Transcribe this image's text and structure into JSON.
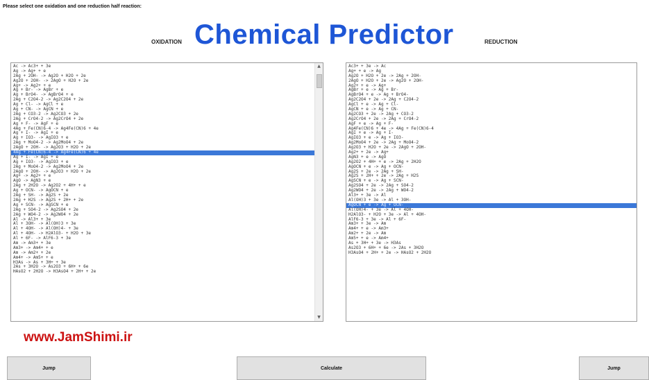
{
  "instruction": "Please select one oxidation and one reduction half reaction:",
  "title": "Chemical Predictor",
  "oxidation_label": "OXIDATION",
  "reduction_label": "REDUCTION",
  "oxidation_list": {
    "selected_index": 18,
    "items": [
      "Ac -> Ac3+ + 3e",
      "Ag -> Ag+ + e",
      "2Ag + 2OH- -> Ag2O + H2O + 2e",
      "Ag2O + 2OH- -> 2AgO + H2O + 2e",
      "Ag+ -> Ag2+ + e",
      "Ag + Br- -> AgBr + e",
      "Ag + BrO4- -> AgBrO4 + e",
      "2Ag + C2O4-2 -> Ag2C2O4 + 2e",
      "Ag + Cl- -> AgCl + e",
      "Ag + CN- -> AgCN + e",
      "2Ag + CO3-2 -> Ag2CO3 + 2e",
      "2Ag + CrO4-2 -> Ag2CrO4 + 2e",
      "Ag + F- -> AgF + e",
      "4Ag + Fe(CN)6-4 -> Ag4Fe(CN)6 + 4e",
      "Ag + I- -> AgI + e",
      "Ag + IO3- -> AgIO3 + e",
      "2Ag + MoO4-2 -> Ag2MoO4 + 2e",
      "2AgO + 2OH- -> Ag2O3 + H2O + 2e",
      "4Ag + Fe(CN)6-4 -> Ag4Fe(CN)6 + 4e",
      "Ag + I- -> AgI + e",
      "Ag + IO3- -> AgIO3 + e",
      "2Ag + MoO4-2 -> Ag2MoO4 + 2e",
      "2AgO + 2OH- -> Ag2O3 + H2O + 2e",
      "Ag+ -> Ag2+ + e",
      "AgO -> AgN3 + e",
      "2Ag + 2H2O -> Ag2O2 + 4H+ + e",
      "Ag + OCN- -> AgOCN + e",
      "2Ag + SH- -> Ag2S + 2e",
      "2Ag + H2S -> Ag2S + 2H+ + 2e",
      "Ag + SCN- -> AgSCN + e",
      "2Ag + SO4-2 -> Ag2SO4 + 2e",
      "2Ag + WO4-2 -> Ag2WO4 + 2e",
      "Al -> Al3+ + 3e",
      "Al + 3OH- -> Al(OH)3 + 3e",
      "Al + 4OH- -> Al(OH)4- + 3e",
      "Al + 4OH- -> H2AlO3- + H2O + 3e",
      "Al + 6F- -> AlF6-3 + 3e",
      "Am -> Am3+ + 3e",
      "Am3+ -> Am4+ + e",
      "Am -> Am2+ + 2e",
      "Am4+ -> Am5+ + e",
      "H3As -> As + 3H+ + 3e",
      "2As + 3H2O -> As2O3 + 6H+ + 6e",
      "HAsO2 + 2H2O -> H3AsO4 + 2H+ + 2e"
    ]
  },
  "reduction_list": {
    "selected_index": 29,
    "items": [
      "Ac3+ + 3e -> Ac",
      "Ag+ + e -> Ag",
      "Ag2O + H2O + 2e -> 2Ag + 2OH-",
      "2AgO + H2O + 2e -> Ag2O + 2OH-",
      "Ag2+ + e -> Ag+",
      "AgBr + e -> Ag + Br-",
      "AgBrO4 + e -> Ag + BrO4-",
      "Ag2C2O4 + 2e -> 2Ag + C2O4-2",
      "AgCl + e -> Ag + Cl-",
      "AgCN + e -> Ag + CN-",
      "Ag2CO3 + 2e -> 2Ag + CO3-2",
      "Ag2CrO4 + 2e -> 2Ag + CrO4-2",
      "AgF + e -> Ag + F-",
      "Ag4Fe(CN)6 + 4e -> 4Ag + Fe(CN)6-4",
      "AgI + e -> Ag + I-",
      "AgIO3 + e -> Ag + IO3-",
      "Ag2MoO4 + 2e -> 2Ag + MoO4-2",
      "Ag2O3 + H2O + 2e -> 2AgO + 2OH-",
      "Ag2+ + 2e -> Ag+",
      "AgN3 + e -> AgO",
      "Ag2O2 + 4H+ + e -> 2Ag + 2H2O",
      "AgOCN + e -> Ag + OCN-",
      "Ag2S + 2e -> 2Ag + SH-",
      "Ag2S + 2H+ + 2e -> 2Ag + H2S",
      "AgSCN + e -> Ag + SCN-",
      "Ag2SO4 + 2e -> 2Ag + SO4-2",
      "Ag2WO4 + 2e -> 2Ag + WO4-2",
      "Al3+ + 3e -> Al",
      "Al(OH)3 + 3e -> Al + 3OH-",
      "AgOCN + e -> Ag + OCN-",
      "Al(OH)4- + 3e -> Al + 4OH-",
      "H2AlO3- + H2O + 3e -> Al + 4OH-",
      "AlF6-3 + 3e -> Al + 6F-",
      "Am3+ + 3e -> Am",
      "Am4+ + e -> Am3+",
      "Am2+ + 2e -> Am",
      "Am5+ + e -> Am4+",
      "As + 3H+ + 3e -> H3As",
      "As2O3 + 6H+ + 6e -> 2As + 3H2O",
      "H3AsO4 + 2H+ + 2e -> HAsO2 + 2H2O"
    ]
  },
  "watermark": "www.JamShimi.ir",
  "buttons": {
    "jump_left": "Jump",
    "calculate": "Calculate",
    "jump_right": "Jump"
  },
  "colors": {
    "title": "#1e56d6",
    "selection": "#3b78d8",
    "watermark": "#cc1212",
    "button_face": "#e1e1e1"
  }
}
